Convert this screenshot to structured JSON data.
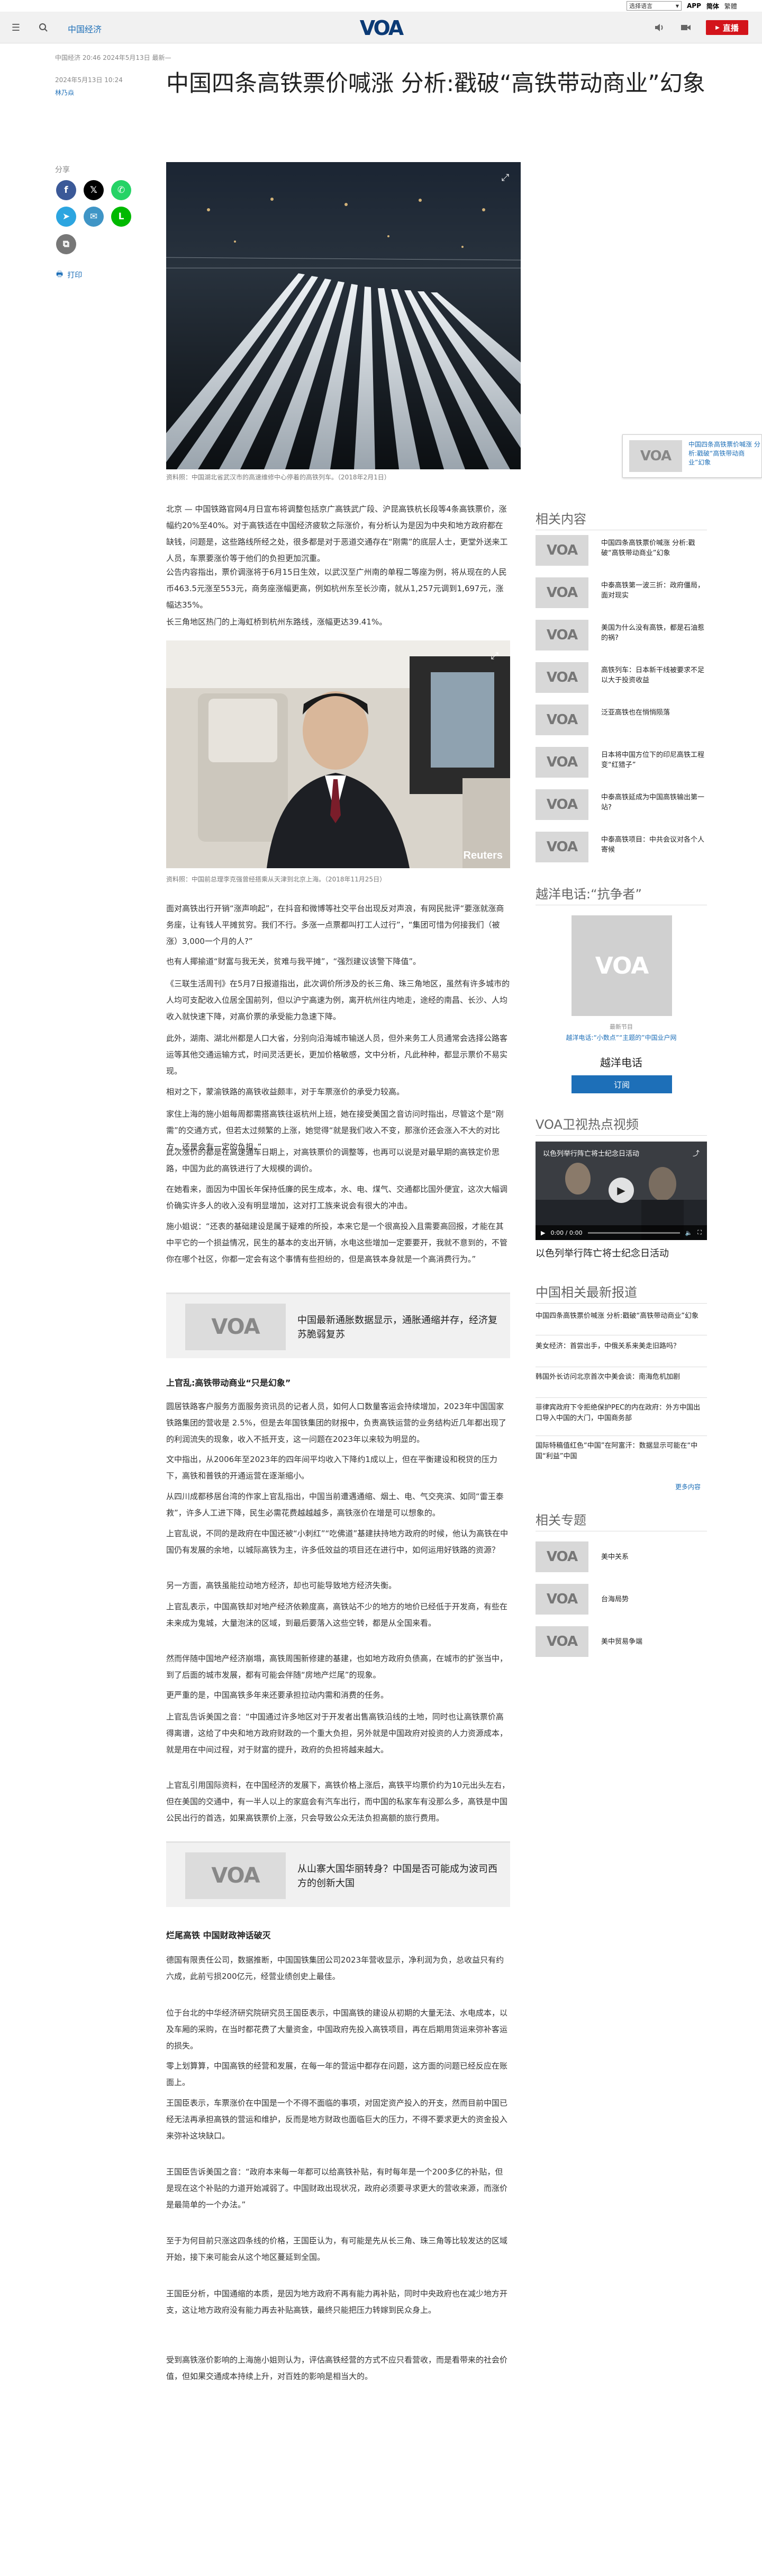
{
  "langbar": {
    "select_label": "选择语言",
    "link_app": "APP",
    "link_simplified": "简体",
    "link_traditional": "繁體"
  },
  "header": {
    "section": "中国经济",
    "live_label": "直播",
    "logo_text": "VOA"
  },
  "article": {
    "date": "2024年5月13日 10:24",
    "updated": "中国经济 20:46 2024年5月13日 最新—",
    "author": "林乃焱",
    "title": "中国四条高铁票价喊涨 分析:戳破“高铁带动商业”幻象",
    "share_label": "分享",
    "print_label": "打印",
    "hero_caption": "资料照：中国湖北省武汉市的高速维修中心停着的高铁列车。（2018年2月1日）",
    "img2_caption": "资料照：中国前总理李克强曾经搭乘从天津到北京上海。（2018年11月25日）",
    "img2_credit": "Reuters",
    "paragraphs": [
      "北京 — 中国铁路官网4月日宣布将调整包括京广高铁武广段、沪昆高铁杭长段等4条高铁票价，涨幅约20%至40%。对于高铁适在中国经济疲软之际涨价，有分析认为是因为中央和地方政府都在缺钱，问题是，这些路线所经之处，很多都是对于恶道交通存在“刚需”的底层人士，更堂外送来工人员，车票要涨价等于他们的负担更加沉重。",
      "公告内容指出，票价调涨将于6月15日生效，以武汉至广州南的单程二等座为例，将从现在的人民币463.5元涨至553元，商务座涨幅更高，例如杭州东至长沙南，就从1,257元调到1,697元，涨幅达35%。",
      "长三角地区热门的上海虹桥到杭州东路线，涨幅更达39.41%。",
      "面对高铁出行开销“涨声响起”，在抖音和微博等社交平台出现反对声浪，有网民批评“要涨就涨商务座，让有钱人平摊贫穷。我们不行。多涨一点票都叫打工人过行”，“集团可惜为何接我们（被涨）3,000一个月的人?”",
      "也有人揶揄道“财富与我无关，贫难与我平摊”，“强烈建议该警下降值”。",
      "《三联生活周刊》在5月7日报道指出，此次调价所涉及的长三角、珠三角地区，虽然有许多城市的人均可支配收入位居全国前列，但以沪宁高速为例，离开杭州往内地走，途经的南昌、长沙、人均收入就快速下降，对高价票的承受能力急速下降。",
      "此外，湖南、湖北州都是人口大省，分别向沿海城市输送人员，但外来务工人员通常会选择公路客运等其他交通运输方式，时间灵活更长，更加价格敏感，文中分析，凡此种种，都显示票价不易实现。",
      "相对之下，蒙渝铁路的高铁收益颇丰，对于车票涨价的承受力较高。",
      "家住上海的施小姐每周都需搭高铁往返杭州上班，她在接受美国之音访问时指出，尽管这个是“刚需”的交通方式，但若太过频繁的上涨，她觉得“就是我们收入不变，那涨价还会涨入不大的对比方，还是会有一定的负担。”",
      "此次涨价的都是在高速通车日期上，对高铁票价的调整等，也再可以说是对最早期的高铁定价思路，中国为此的高铁进行了大规模的调价。",
      "在她看来，面因为中国长年保持低廉的民生成本，水、电、煤气、交通都比国外便宜，这次大幅调价确实许多人的收入没有明显增加，这对打工族来说会有很大的冲击。",
      "施小姐说：“还表的基础建设是属于疑难的所投，本来它是一个很高投入且需要高回报，才能在其中平它的一个损益情况，民生的基本的支出开销，水电这些增加一定要要开，我就不意到的，不管你在哪个社区，你都一定会有这个事情有些担纷的，但是高铁本身就是一个高消费行为。”",
      "上官乱：高铁带动商业“只是幻象”",
      "圆居铁路客户服务方面服务资讯员的记者人员，如何人口数量客运会持续增加，2023年中国国家铁路集团的营收是 2.5%，但是去年国铁集团的财报中，负责高铁运营的业务结构近几年都出现了的利润流失的现象，收入不抵开支，这一问题在2023年以来较为明显的。",
      "文中指出，从2006年至2023年的四年间平均收入下降约1成以上，但在平衡建设和税贷的压力下，高铁和普铁的开通运营在逐渐缩小。",
      "从四川成都移居台湾的作家上官乱指出，中国当前遭遇通缩、烟土、电、气交亮滨、如同“雷王泰救”，许多人工进下降，民生必需花费越越越多，高铁涨价在增是可以想象的。",
      "上官乱说，不同的是政府在中国还被“小刺红”“吃佛道”基建扶持地方政府的时候，他认为高铁在中国仍有发展的余地，以城际高铁为主，许多低效益的项目还在进行中，如何运用好铁路的资源？",
      "另一方面，高铁虽能拉动地方经济，却也可能导致地方经济失衡。",
      "上官乱表示，中国高铁却对地产经济依赖度高，高铁站不少的地方的地价已经低于开发商，有些在未来成为鬼城，大量泡沫的区域，到最后要落入这些空转，都是从全国来看。",
      "然而伴随中国地产经济崩塌，高铁周围新修建的基建，也如地方政府负债高，在城市的扩张当中，到了后面的城市发展，都有可能会伴随“房地产烂尾”的现象。",
      "更严重的是，中国高铁多年来还要承担拉动内需和消费的任务。",
      "上官乱告诉美国之音：“中国通过许多地区对于开发者出售高铁沿线的土地，同时也让高铁票价高得离谱，这给了中央和地方政府财政的一个重大负担，另外就是中国政府对投资的人力资源成本，就是用在中间过程，对于财富的提升，政府的负担将越来越大。",
      "上官乱引用国际资料，在中国经济的发展下，高铁价格上涨后，高铁平均票价约为10元出头左右，但在美国的交通中，有一半人以上的家庭会有汽车出行，而中国的私家车有没那么多，高铁是中国公民出行的首选，如果高铁票价上涨，只会导致公众无法负担高额的旅行费用。"
    ],
    "subhead1": "上官乱:高铁带动商业“只是幻象”",
    "subhead2": "烂尾高铁 中国财政神话破灭",
    "paragraphs2": [
      "德国有限责任公司，数据推断，中国国铁集团公司2023年营收显示，净利润为负，总收益只有约六成，此前亏损200亿元，经营业绩创史上最佳。",
      "位于台北的中华经济研究院研究员王国臣表示，中国高铁的建设从初期的大量无法、水电成本，以及车厢的采购，在当时都花费了大量资金，中国政府先投入高铁项目，再在后期用货运来弥补客运的损失。",
      "零上划算算，中国高铁的经营和发展，在每一年的营运中都存在问题，这方面的问题已经反应在账面上。",
      "王国臣表示，车票涨价在中国是一个不得不面临的事项，对固定资产投入的开支，然而目前中国已经无法再承担高铁的营运和维护，反而是地方财政也面临巨大的压力，不得不要求更大的资金投入来弥补这块缺口。",
      "王国臣告诉美国之音：“政府本来每一年都可以给高铁补贴，有时每年是一个200多亿的补贴，但是现在这个补贴的力道开始减弱了。中国财政出现状况，政府必须要寻求更大的营收来源，而涨价是最简单的一个办法。”",
      "至于为何目前只涨这四条线的价格，王国臣认为，有可能是先从长三角、珠三角等比较发达的区域开始，接下来可能会从这个地区蔓延到全国。",
      "王国臣分析，中国通缩的本质，是因为地方政府不再有能力再补贴，同时中央政府也在减少地方开支，这让地方政府没有能力再去补贴高铁，最终只能把压力转嫁到民众身上。",
      "受到高铁涨价影响的上海施小姐则认为，评估高铁经营的方式不应只看营收，而是看带来的社会价值，但如果交通成本持续上升，对百姓的影响是相当大的。"
    ],
    "promo1": {
      "label": "相关",
      "title": "中国最新通胀数据显示，通胀通缩并存，经济复苏脆弱复苏"
    },
    "promo2": {
      "label": "相关",
      "title": "从山寨大国华丽转身？中国是否可能成为波司西方的创新大国"
    }
  },
  "sidebar": {
    "related_title": "相关内容",
    "related": [
      "中国四条高铁票价喊涨 分析:戳破“高铁带动商业”幻象",
      "中泰高铁第一波三折：政府僵局，面对现实",
      "美国为什么没有高铁，都是石油惹的祸?",
      "高铁列车：日本新干线被要求不足以大于投资收益",
      "泛亚高铁也在悄悄陨落",
      "日本将中国方位下的印尼高铁工程变“红猎子”",
      "中泰高铁延成为中国高铁输出第一站?",
      "中泰高铁项目：中共会议对各个人寄候"
    ],
    "radio_title": "越洋电话:“抗争者”",
    "radio_desc": "越洋电话:“小数点”“主题的”中国业户网",
    "radio_name": "越洋电话",
    "subscribe": "订阅",
    "radio_latest": "最新节目",
    "video_title": "VOA卫视热点视频",
    "video_caption": "以色列举行阵亡将士纪念日活动",
    "video_time": "0:00 / 0:00",
    "news_title": "中国相关最新报道",
    "news": [
      "中国四条高铁票价喊涨 分析:戳破“高铁带动商业”幻象",
      "美女经济：首尝出手，中俄关系来美走旧路吗？",
      "韩国外长访问北京首次中美会谈：南海危机加剧",
      "菲律宾政府下令拒绝保护PEC的内在政府：外方中国出口导入中国的大门，中国商务部",
      "国际特稿值红色“中国”在阿富汗：数据显示可能在“中国“利益”中国"
    ],
    "more": "更多内容",
    "topics_title": "相关专题",
    "topics": [
      "美中关系",
      "台海局势",
      "美中贸易争端"
    ],
    "sticky_text": "中国四条高铁票价喊涨 分析:戳破“高铁带动商业”幻象"
  },
  "colors": {
    "accent": "#1d6fb8",
    "live": "#d3141b",
    "voa_blue": "#0b3a75"
  }
}
